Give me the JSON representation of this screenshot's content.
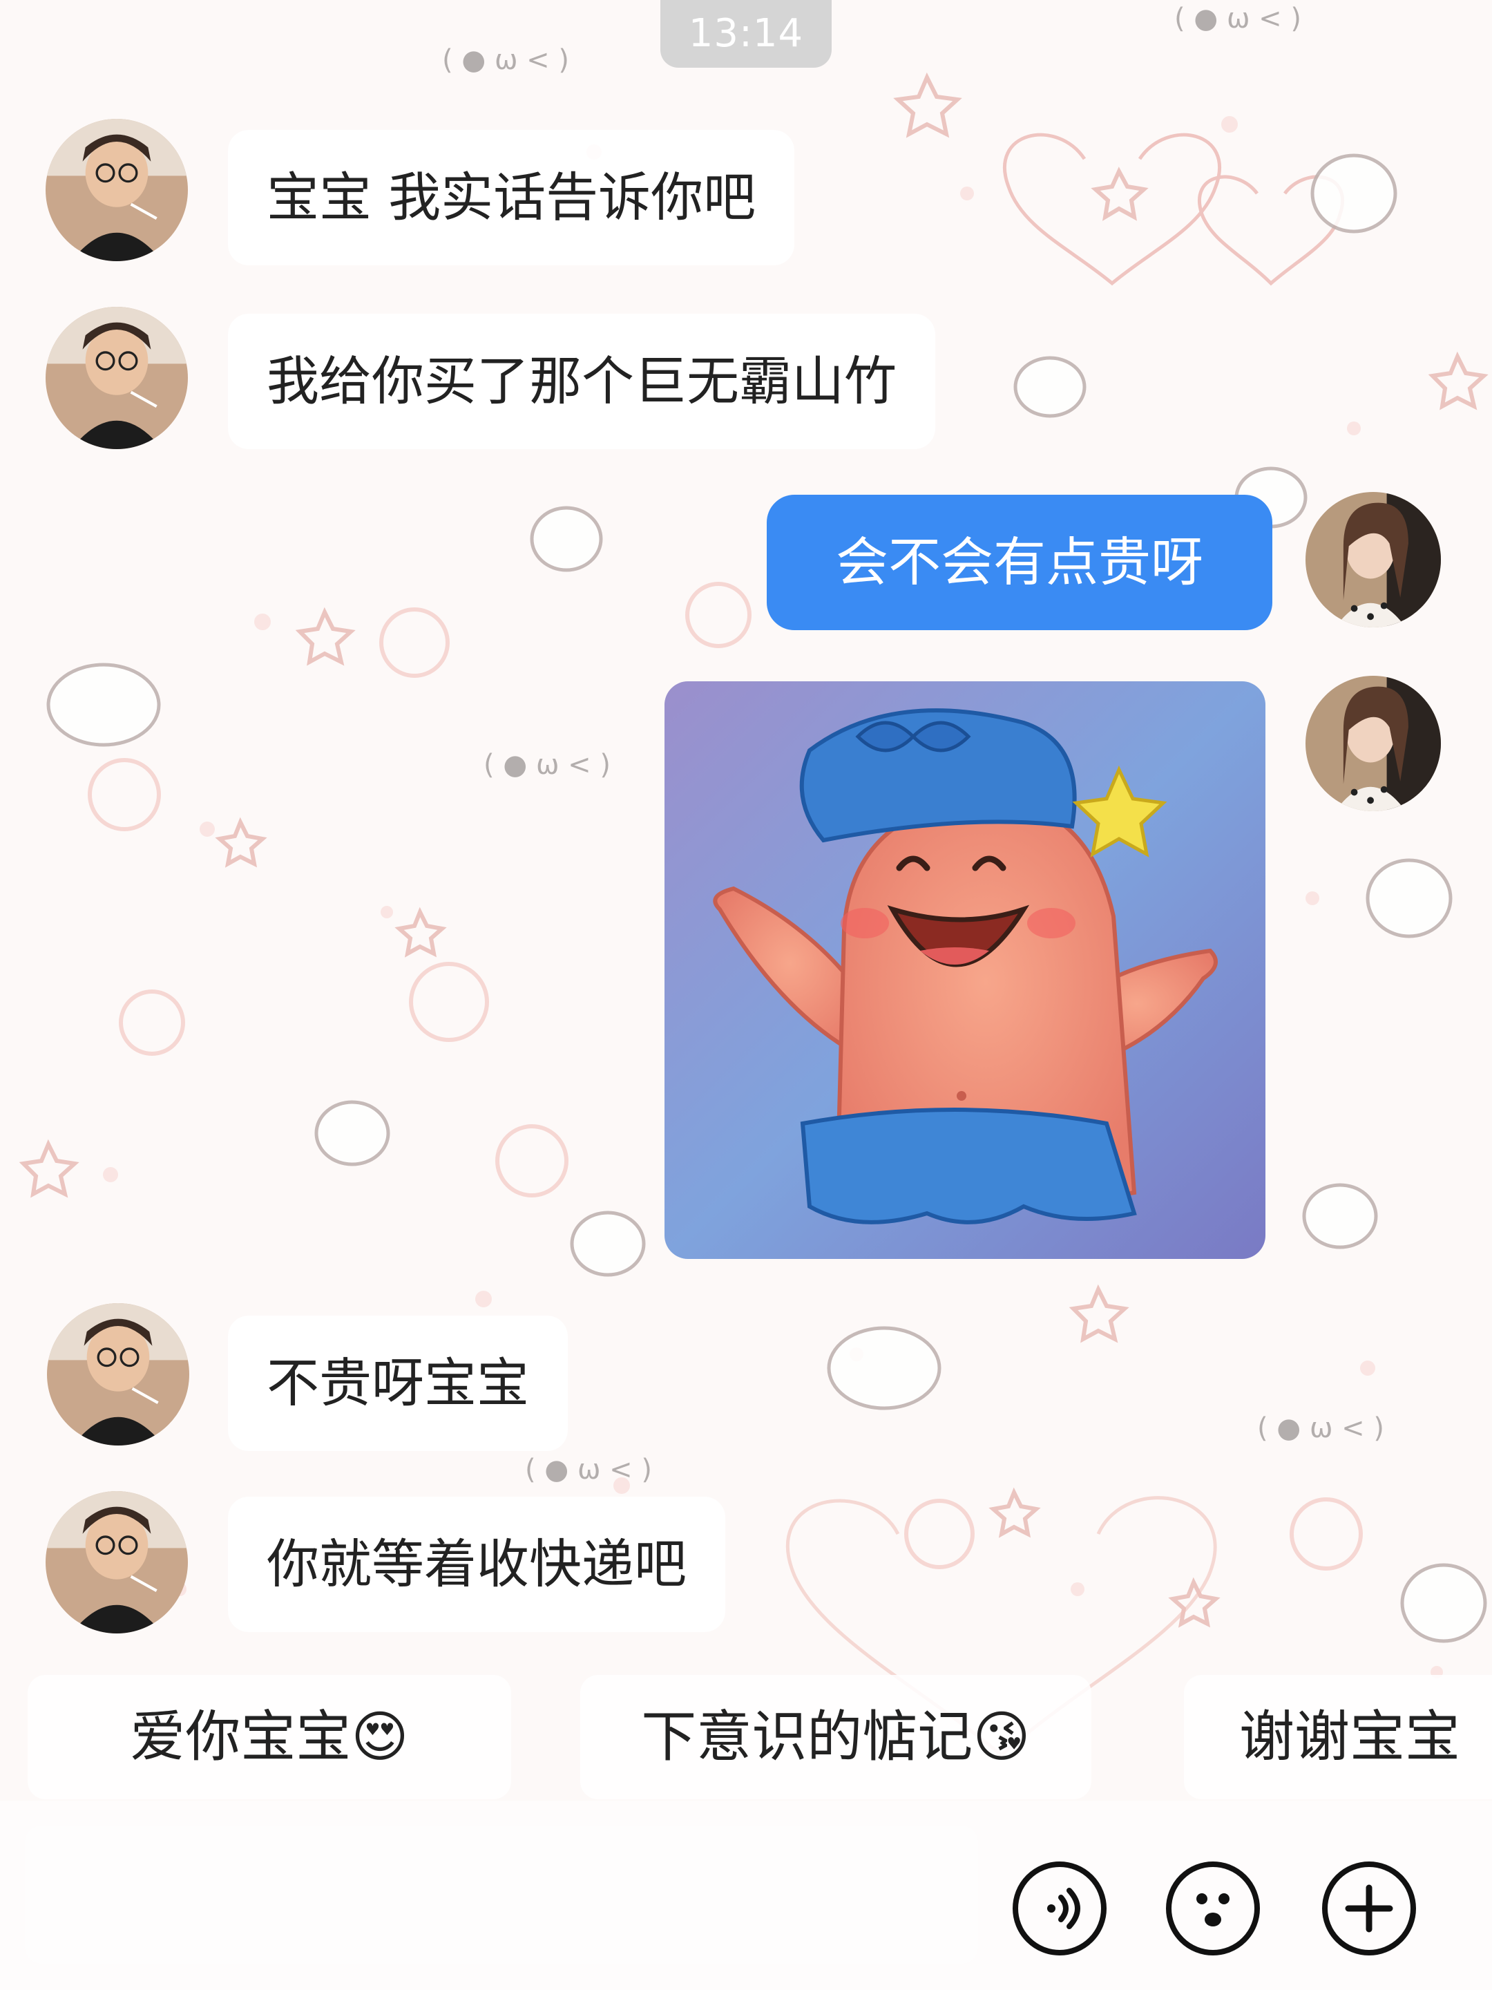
{
  "status": {
    "time": "13:14"
  },
  "messages": [
    {
      "sender": "contact",
      "type": "text",
      "text": "宝宝 我实话告诉你吧"
    },
    {
      "sender": "contact",
      "type": "text",
      "text": "我给你买了那个巨无霸山竹"
    },
    {
      "sender": "self",
      "type": "text",
      "text": "会不会有点贵呀"
    },
    {
      "sender": "self",
      "type": "sticker",
      "sticker": "patrick-star-shower-cap-sticker"
    },
    {
      "sender": "contact",
      "type": "text",
      "text": "不贵呀宝宝"
    },
    {
      "sender": "contact",
      "type": "text",
      "text": "你就等着收快递吧"
    }
  ],
  "suggestions": [
    {
      "text": "爱你宝宝😍"
    },
    {
      "text": "下意识的惦记😘"
    },
    {
      "text": "谢谢宝宝"
    }
  ],
  "input_bar": {
    "placeholder": "",
    "icons": [
      "voice-icon",
      "emoji-icon",
      "plus-icon"
    ]
  },
  "colors": {
    "self_bubble": "#3a8bf3",
    "background": "#fdf9f8",
    "contact_bubble": "#ffffff"
  }
}
